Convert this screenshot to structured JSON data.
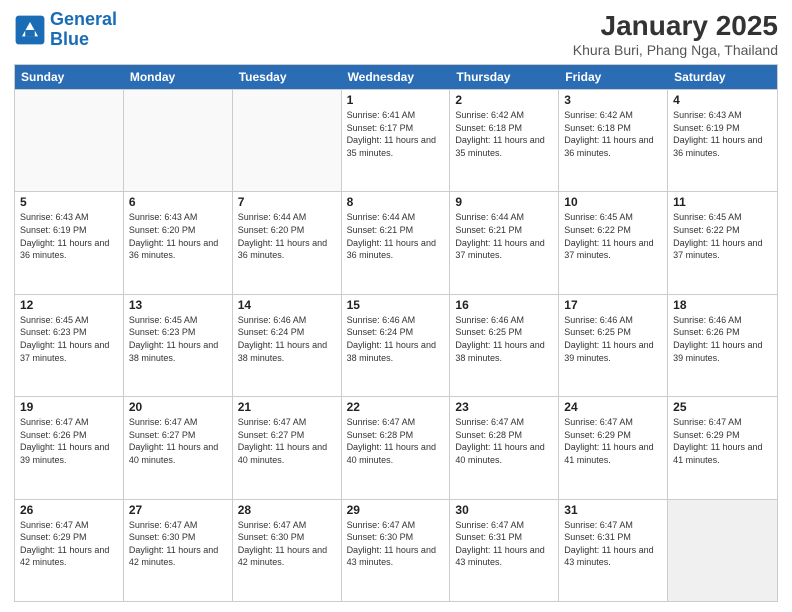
{
  "logo": {
    "line1": "General",
    "line2": "Blue"
  },
  "title": "January 2025",
  "subtitle": "Khura Buri, Phang Nga, Thailand",
  "header": {
    "days": [
      "Sunday",
      "Monday",
      "Tuesday",
      "Wednesday",
      "Thursday",
      "Friday",
      "Saturday"
    ]
  },
  "weeks": [
    [
      {
        "day": "",
        "empty": true
      },
      {
        "day": "",
        "empty": true
      },
      {
        "day": "",
        "empty": true
      },
      {
        "day": "1",
        "sunrise": "6:41 AM",
        "sunset": "6:17 PM",
        "daylight": "11 hours and 35 minutes."
      },
      {
        "day": "2",
        "sunrise": "6:42 AM",
        "sunset": "6:18 PM",
        "daylight": "11 hours and 35 minutes."
      },
      {
        "day": "3",
        "sunrise": "6:42 AM",
        "sunset": "6:18 PM",
        "daylight": "11 hours and 36 minutes."
      },
      {
        "day": "4",
        "sunrise": "6:43 AM",
        "sunset": "6:19 PM",
        "daylight": "11 hours and 36 minutes."
      }
    ],
    [
      {
        "day": "5",
        "sunrise": "6:43 AM",
        "sunset": "6:19 PM",
        "daylight": "11 hours and 36 minutes."
      },
      {
        "day": "6",
        "sunrise": "6:43 AM",
        "sunset": "6:20 PM",
        "daylight": "11 hours and 36 minutes."
      },
      {
        "day": "7",
        "sunrise": "6:44 AM",
        "sunset": "6:20 PM",
        "daylight": "11 hours and 36 minutes."
      },
      {
        "day": "8",
        "sunrise": "6:44 AM",
        "sunset": "6:21 PM",
        "daylight": "11 hours and 36 minutes."
      },
      {
        "day": "9",
        "sunrise": "6:44 AM",
        "sunset": "6:21 PM",
        "daylight": "11 hours and 37 minutes."
      },
      {
        "day": "10",
        "sunrise": "6:45 AM",
        "sunset": "6:22 PM",
        "daylight": "11 hours and 37 minutes."
      },
      {
        "day": "11",
        "sunrise": "6:45 AM",
        "sunset": "6:22 PM",
        "daylight": "11 hours and 37 minutes."
      }
    ],
    [
      {
        "day": "12",
        "sunrise": "6:45 AM",
        "sunset": "6:23 PM",
        "daylight": "11 hours and 37 minutes."
      },
      {
        "day": "13",
        "sunrise": "6:45 AM",
        "sunset": "6:23 PM",
        "daylight": "11 hours and 38 minutes."
      },
      {
        "day": "14",
        "sunrise": "6:46 AM",
        "sunset": "6:24 PM",
        "daylight": "11 hours and 38 minutes."
      },
      {
        "day": "15",
        "sunrise": "6:46 AM",
        "sunset": "6:24 PM",
        "daylight": "11 hours and 38 minutes."
      },
      {
        "day": "16",
        "sunrise": "6:46 AM",
        "sunset": "6:25 PM",
        "daylight": "11 hours and 38 minutes."
      },
      {
        "day": "17",
        "sunrise": "6:46 AM",
        "sunset": "6:25 PM",
        "daylight": "11 hours and 39 minutes."
      },
      {
        "day": "18",
        "sunrise": "6:46 AM",
        "sunset": "6:26 PM",
        "daylight": "11 hours and 39 minutes."
      }
    ],
    [
      {
        "day": "19",
        "sunrise": "6:47 AM",
        "sunset": "6:26 PM",
        "daylight": "11 hours and 39 minutes."
      },
      {
        "day": "20",
        "sunrise": "6:47 AM",
        "sunset": "6:27 PM",
        "daylight": "11 hours and 40 minutes."
      },
      {
        "day": "21",
        "sunrise": "6:47 AM",
        "sunset": "6:27 PM",
        "daylight": "11 hours and 40 minutes."
      },
      {
        "day": "22",
        "sunrise": "6:47 AM",
        "sunset": "6:28 PM",
        "daylight": "11 hours and 40 minutes."
      },
      {
        "day": "23",
        "sunrise": "6:47 AM",
        "sunset": "6:28 PM",
        "daylight": "11 hours and 40 minutes."
      },
      {
        "day": "24",
        "sunrise": "6:47 AM",
        "sunset": "6:29 PM",
        "daylight": "11 hours and 41 minutes."
      },
      {
        "day": "25",
        "sunrise": "6:47 AM",
        "sunset": "6:29 PM",
        "daylight": "11 hours and 41 minutes."
      }
    ],
    [
      {
        "day": "26",
        "sunrise": "6:47 AM",
        "sunset": "6:29 PM",
        "daylight": "11 hours and 42 minutes."
      },
      {
        "day": "27",
        "sunrise": "6:47 AM",
        "sunset": "6:30 PM",
        "daylight": "11 hours and 42 minutes."
      },
      {
        "day": "28",
        "sunrise": "6:47 AM",
        "sunset": "6:30 PM",
        "daylight": "11 hours and 42 minutes."
      },
      {
        "day": "29",
        "sunrise": "6:47 AM",
        "sunset": "6:30 PM",
        "daylight": "11 hours and 43 minutes."
      },
      {
        "day": "30",
        "sunrise": "6:47 AM",
        "sunset": "6:31 PM",
        "daylight": "11 hours and 43 minutes."
      },
      {
        "day": "31",
        "sunrise": "6:47 AM",
        "sunset": "6:31 PM",
        "daylight": "11 hours and 43 minutes."
      },
      {
        "day": "",
        "empty": true
      }
    ]
  ]
}
